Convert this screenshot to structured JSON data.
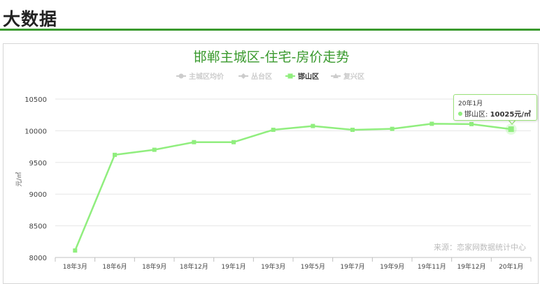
{
  "page": {
    "section_title": "大数据"
  },
  "colors": {
    "accent_green": "#3a9a2e",
    "series_green": "#90ee7e",
    "legend_inactive": "#cccccc",
    "grid": "#e6e6e6",
    "title_green": "#3a9a2e"
  },
  "tooltip": {
    "date": "20年1月",
    "series": "邯山区",
    "value_text": "10025元/㎡"
  },
  "chart_data": {
    "type": "line",
    "title": "邯郸主城区-住宅-房价走势",
    "ylabel": "元/㎡",
    "xlabel": "",
    "credit": "来源：恋家网数据统计中心",
    "categories": [
      "18年3月",
      "18年6月",
      "18年9月",
      "18年12月",
      "19年1月",
      "19年3月",
      "19年5月",
      "19年7月",
      "19年9月",
      "19年11月",
      "19年12月",
      "20年1月"
    ],
    "ylim": [
      8000,
      10500
    ],
    "yticks": [
      8000,
      8500,
      9000,
      9500,
      10000,
      10500
    ],
    "grid": true,
    "legend_position": "top-center",
    "legend": [
      {
        "name": "主城区均价",
        "active": false,
        "marker": "circle"
      },
      {
        "name": "丛台区",
        "active": false,
        "marker": "diamond"
      },
      {
        "name": "邯山区",
        "active": true,
        "marker": "square"
      },
      {
        "name": "复兴区",
        "active": false,
        "marker": "triangle"
      }
    ],
    "series": [
      {
        "name": "邯山区",
        "values": [
          8110,
          9620,
          9700,
          9820,
          9820,
          10015,
          10075,
          10015,
          10030,
          10110,
          10105,
          10025
        ]
      }
    ]
  }
}
